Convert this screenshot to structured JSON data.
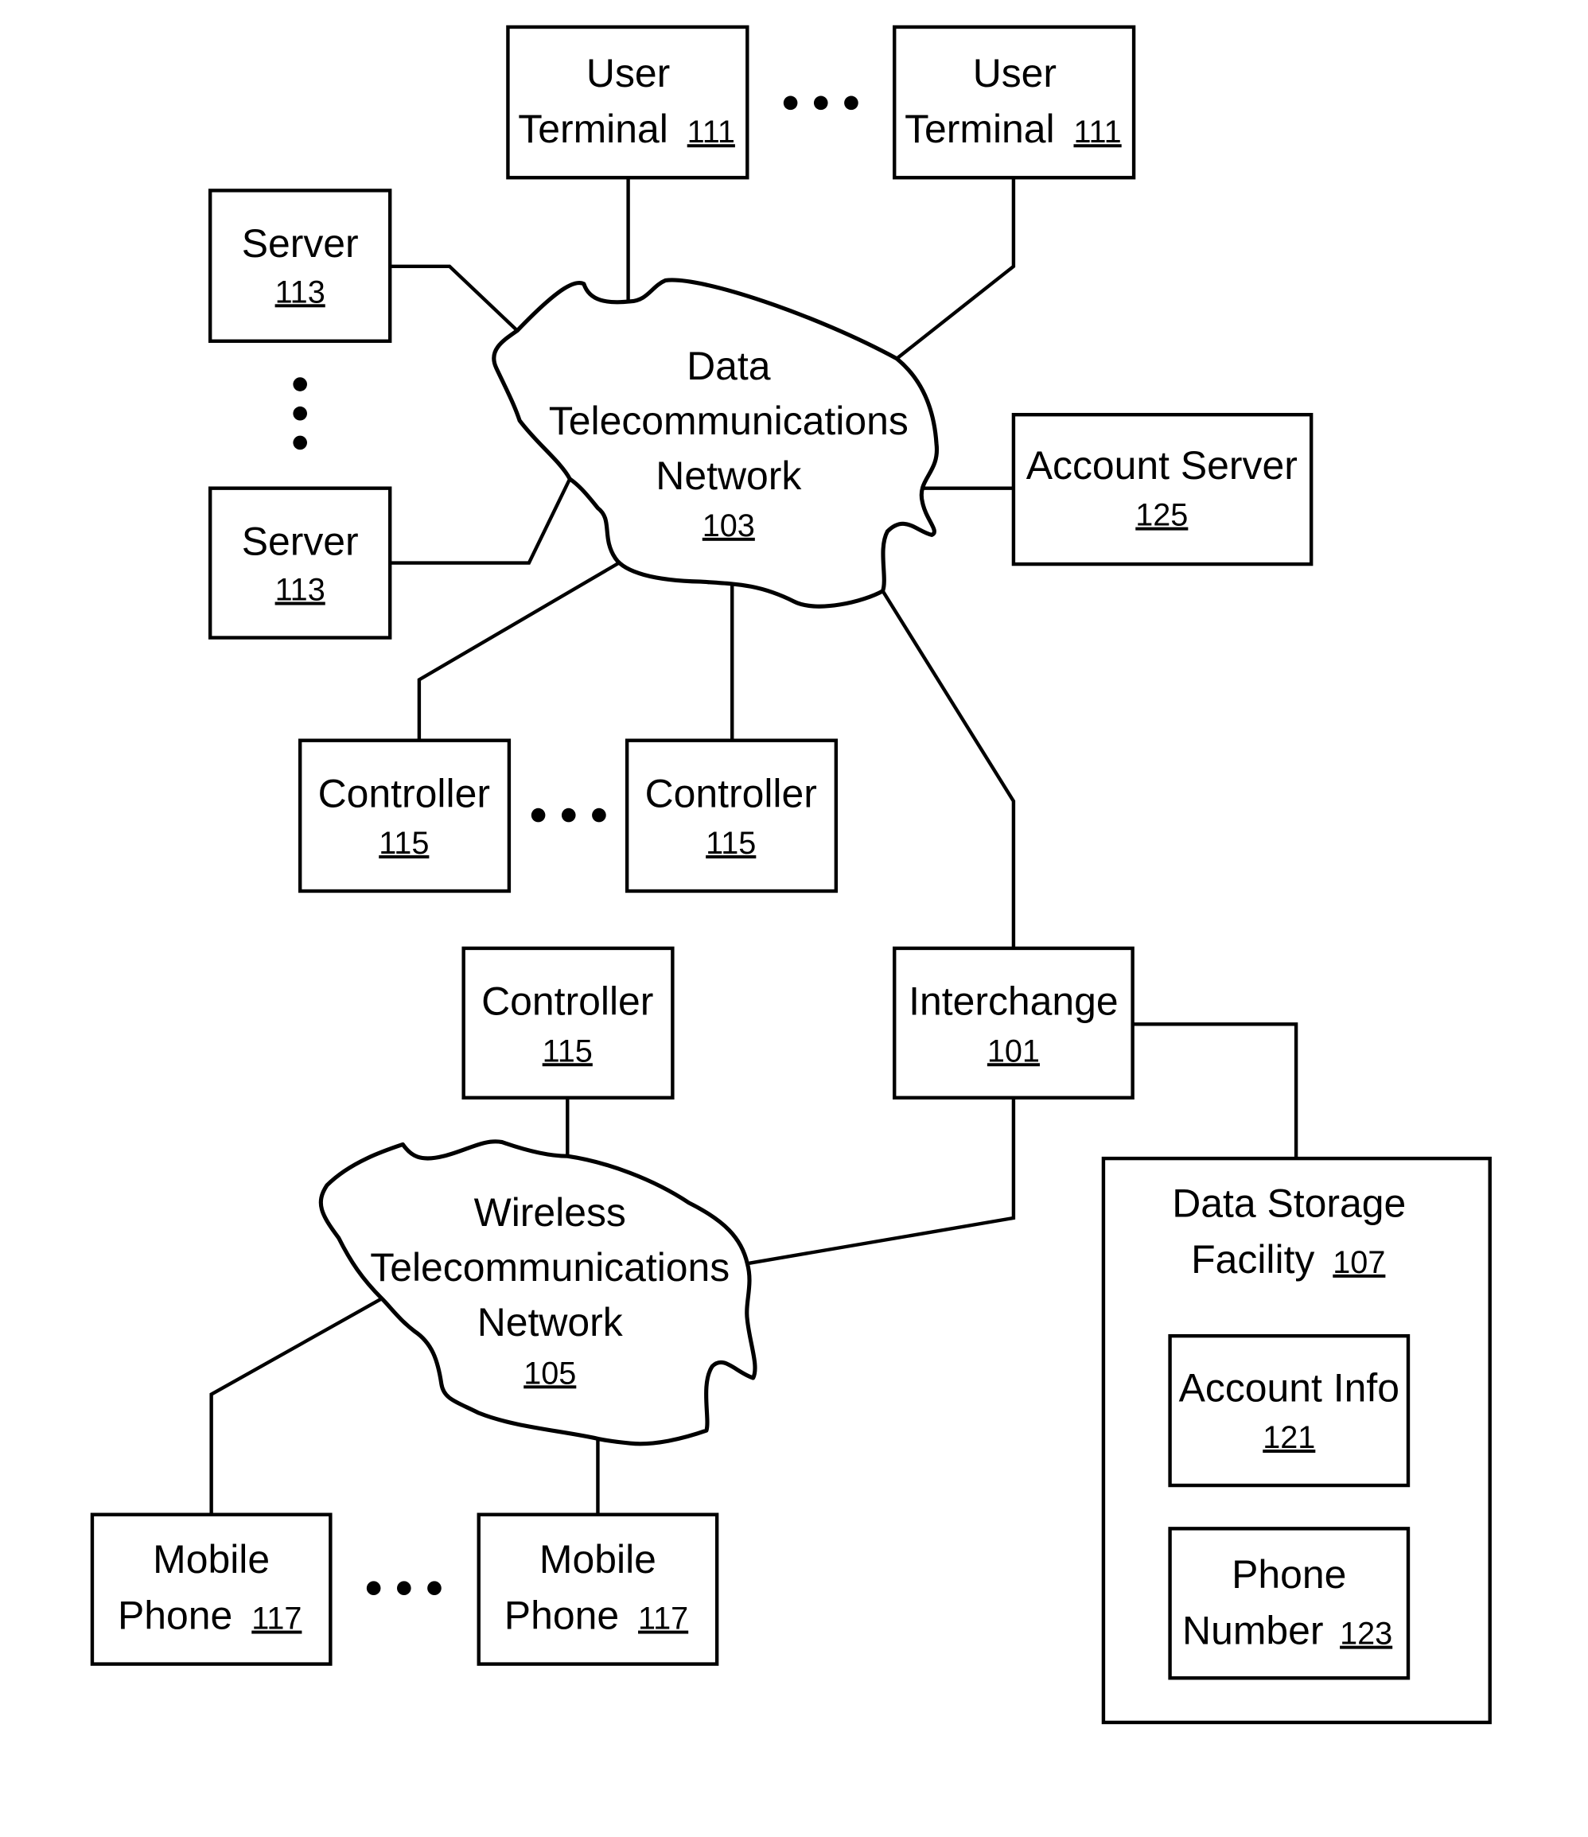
{
  "diagram": {
    "nodes": {
      "user_terminal_1": {
        "line1": "User",
        "line2": "Terminal",
        "ref": "111"
      },
      "user_terminal_2": {
        "line1": "User",
        "line2": "Terminal",
        "ref": "111"
      },
      "server_1": {
        "line1": "Server",
        "ref": "113"
      },
      "server_2": {
        "line1": "Server",
        "ref": "113"
      },
      "data_network": {
        "line1": "Data",
        "line2": "Telecommunications",
        "line3": "Network",
        "ref": "103"
      },
      "account_server": {
        "line1": "Account Server",
        "ref": "125"
      },
      "controller_1": {
        "line1": "Controller",
        "ref": "115"
      },
      "controller_2": {
        "line1": "Controller",
        "ref": "115"
      },
      "controller_3": {
        "line1": "Controller",
        "ref": "115"
      },
      "interchange": {
        "line1": "Interchange",
        "ref": "101"
      },
      "wireless_network": {
        "line1": "Wireless",
        "line2": "Telecommunications",
        "line3": "Network",
        "ref": "105"
      },
      "data_storage": {
        "line1": "Data Storage",
        "line2": "Facility",
        "ref": "107"
      },
      "account_info": {
        "line1": "Account Info",
        "ref": "121"
      },
      "phone_number": {
        "line1": "Phone",
        "line2": "Number",
        "ref": "123"
      },
      "mobile_phone_1": {
        "line1": "Mobile",
        "line2": "Phone",
        "ref": "117"
      },
      "mobile_phone_2": {
        "line1": "Mobile",
        "line2": "Phone",
        "ref": "117"
      }
    },
    "ellipsis_icons": [
      "ellipsis-user-terminals",
      "ellipsis-servers",
      "ellipsis-controllers",
      "ellipsis-mobile-phones"
    ],
    "connections": [
      [
        "user_terminal_1",
        "data_network"
      ],
      [
        "user_terminal_2",
        "data_network"
      ],
      [
        "server_1",
        "data_network"
      ],
      [
        "server_2",
        "data_network"
      ],
      [
        "account_server",
        "data_network"
      ],
      [
        "controller_1",
        "data_network"
      ],
      [
        "controller_2",
        "data_network"
      ],
      [
        "interchange",
        "data_network"
      ],
      [
        "interchange",
        "data_storage"
      ],
      [
        "interchange",
        "wireless_network"
      ],
      [
        "controller_3",
        "wireless_network"
      ],
      [
        "mobile_phone_1",
        "wireless_network"
      ],
      [
        "mobile_phone_2",
        "wireless_network"
      ],
      [
        "account_info",
        "phone_number"
      ]
    ]
  }
}
